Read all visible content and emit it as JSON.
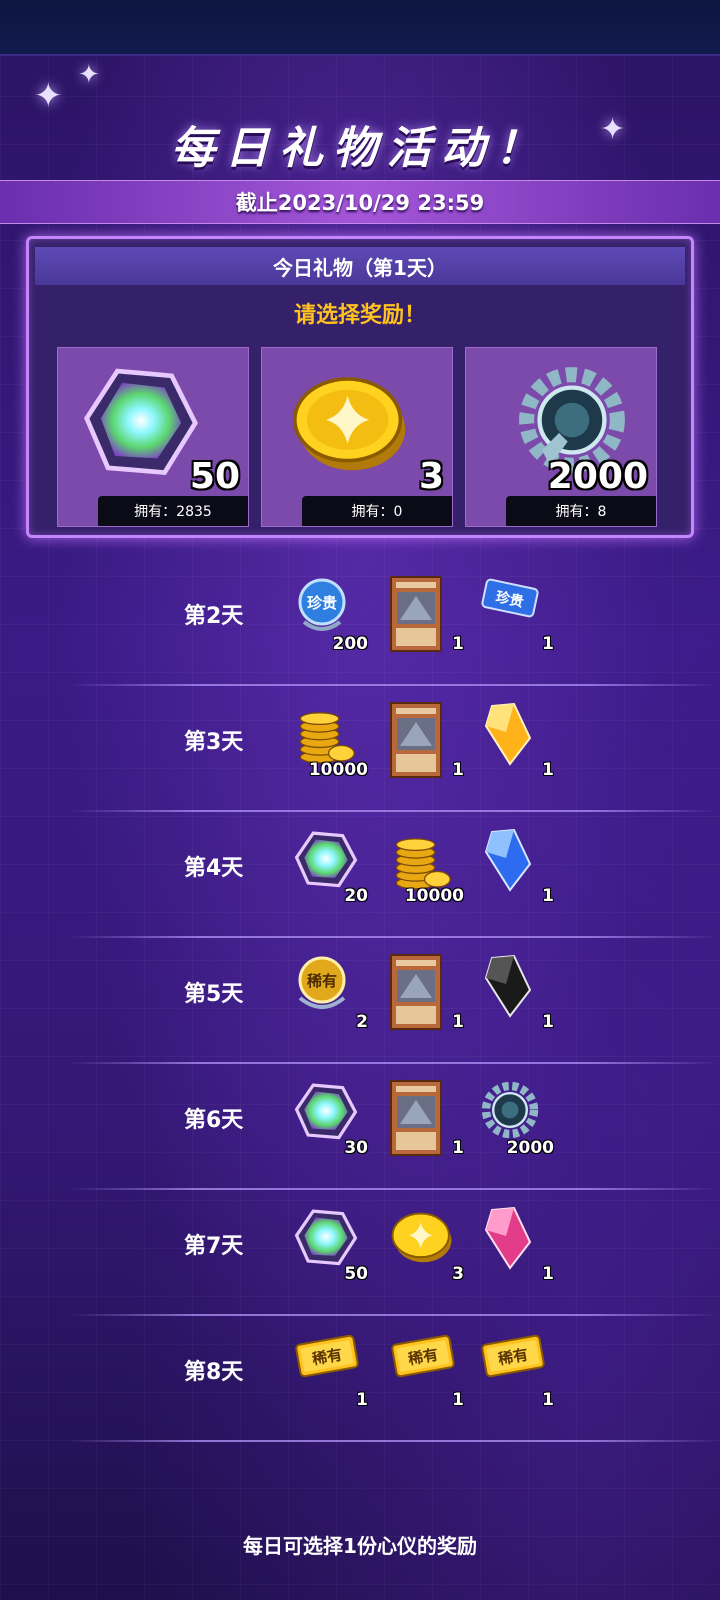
{
  "header": {
    "title": "每日礼物活动！",
    "deadline": "截止2023/10/29 23:59"
  },
  "today": {
    "header": "今日礼物（第1天）",
    "prompt": "请选择奖励！",
    "options": [
      {
        "icon": "gem-icon",
        "amount": "50",
        "owned": "拥有：2835"
      },
      {
        "icon": "gold-coin-icon",
        "amount": "3",
        "owned": "拥有：0"
      },
      {
        "icon": "gear-token-icon",
        "amount": "2000",
        "owned": "拥有：8"
      }
    ]
  },
  "days": [
    {
      "label": "第2天",
      "items": [
        {
          "icon": "precious-orb-icon",
          "count": "200"
        },
        {
          "icon": "card-icon",
          "count": "1"
        },
        {
          "icon": "precious-ticket-icon",
          "count": "1"
        }
      ]
    },
    {
      "label": "第3天",
      "items": [
        {
          "icon": "gold-stack-icon",
          "count": "10000"
        },
        {
          "icon": "card-icon",
          "count": "1"
        },
        {
          "icon": "orange-crystal-icon",
          "count": "1"
        }
      ]
    },
    {
      "label": "第4天",
      "items": [
        {
          "icon": "gem-icon",
          "count": "20"
        },
        {
          "icon": "gold-stack-icon",
          "count": "10000"
        },
        {
          "icon": "blue-crystal-icon",
          "count": "1"
        }
      ]
    },
    {
      "label": "第5天",
      "items": [
        {
          "icon": "rare-orb-icon",
          "count": "2"
        },
        {
          "icon": "card-icon",
          "count": "1"
        },
        {
          "icon": "black-crystal-icon",
          "count": "1"
        }
      ]
    },
    {
      "label": "第6天",
      "items": [
        {
          "icon": "gem-icon",
          "count": "30"
        },
        {
          "icon": "card-icon",
          "count": "1"
        },
        {
          "icon": "gear-token-icon",
          "count": "2000"
        }
      ]
    },
    {
      "label": "第7天",
      "items": [
        {
          "icon": "gem-icon",
          "count": "50"
        },
        {
          "icon": "gold-coin-icon",
          "count": "3"
        },
        {
          "icon": "pink-crystal-icon",
          "count": "1"
        }
      ]
    },
    {
      "label": "第8天",
      "items": [
        {
          "icon": "rare-ticket-icon",
          "count": "1"
        },
        {
          "icon": "rare-ticket-icon",
          "count": "1"
        },
        {
          "icon": "rare-ticket-icon",
          "count": "1"
        }
      ]
    }
  ],
  "footer": "每日可选择1份心仪的奖励",
  "icon_texts": {
    "precious": "珍贵",
    "rare": "稀有"
  },
  "colors": {
    "accent": "#ffc21e",
    "panel_border": "#c486ff",
    "card_bg": "#7c4aab"
  }
}
